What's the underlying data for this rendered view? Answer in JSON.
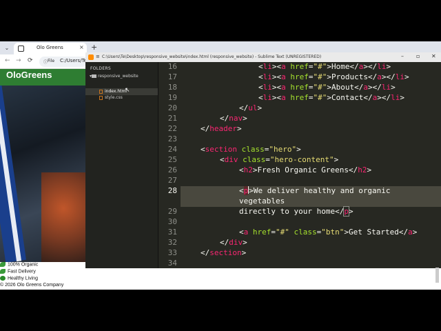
{
  "browser": {
    "tab_title": "Olo Greens",
    "tab_close": "×",
    "new_tab": "+",
    "address_chip": "File",
    "address_url": "C:/Users/Te/D",
    "brand": "OloGreens",
    "features": [
      "100% Organic",
      "Fast Delivery",
      "Healthy Living"
    ],
    "footer": "© 2026 Olo Greens Company"
  },
  "sublime": {
    "title": "C:\\Users\\Te\\Desktop\\responsive_website\\index.html (responsive_website) - Sublime Text (UNREGISTERED)",
    "sidebar": {
      "header": "FOLDERS",
      "folder": "responsive_website",
      "files": [
        "index.html",
        "style.css"
      ],
      "selected_file": "index.html"
    },
    "line_numbers": [
      "16",
      "17",
      "18",
      "19",
      "20",
      "21",
      "22",
      "23",
      "24",
      "25",
      "26",
      "27",
      "28",
      "",
      "29",
      "30",
      "31",
      "32",
      "33",
      "34"
    ],
    "current_line": "28"
  },
  "colors": {
    "tag": "#f92672",
    "attr": "#a6e22e",
    "string": "#e6db74",
    "text": "#f8f8f2",
    "brand_green": "#2e7d32"
  }
}
